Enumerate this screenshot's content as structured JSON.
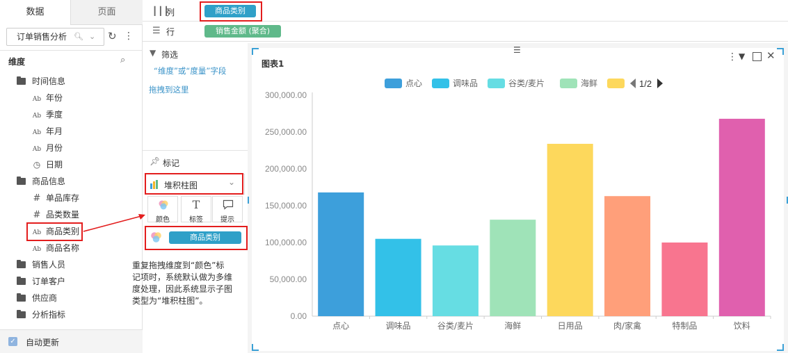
{
  "left_panel": {
    "tabs": [
      "数据",
      "页面"
    ],
    "dataset": "订单销售分析",
    "dimension_title": "维度",
    "tree": [
      {
        "type": "folder",
        "label": "时间信息",
        "children": [
          {
            "type": "text",
            "label": "年份"
          },
          {
            "type": "text",
            "label": "季度"
          },
          {
            "type": "text",
            "label": "年月"
          },
          {
            "type": "text",
            "label": "月份"
          },
          {
            "type": "date",
            "label": "日期"
          }
        ]
      },
      {
        "type": "folder",
        "label": "商品信息",
        "children": [
          {
            "type": "number",
            "label": "单品库存"
          },
          {
            "type": "number",
            "label": "品类数量"
          },
          {
            "type": "text",
            "label": "商品类别"
          },
          {
            "type": "text",
            "label": "商品名称"
          }
        ]
      },
      {
        "type": "folder",
        "label": "销售人员"
      },
      {
        "type": "folder",
        "label": "订单客户"
      },
      {
        "type": "folder",
        "label": "供应商"
      },
      {
        "type": "folder",
        "label": "分析指标"
      }
    ],
    "auto_update": "自动更新"
  },
  "shelf": {
    "column_label": "列",
    "column_pill": "商品类别",
    "row_label": "行",
    "row_pill": "销售金额 (聚合)"
  },
  "filter": {
    "title": "筛选",
    "hint_line1": "“维度”或“度量”字段",
    "hint_line2": "拖拽到这里"
  },
  "marks": {
    "title": "标记",
    "chart_type": "堆积柱图",
    "buttons": [
      "颜色",
      "标签",
      "提示"
    ],
    "color_field": "商品类别"
  },
  "annotation": {
    "lines": [
      "重复拖拽维度到“颜色”标",
      "记项时，系统默认做为多维",
      "度处理，因此系统显示子图",
      "类型为“堆积柱图”。"
    ]
  },
  "chart_data": {
    "type": "bar",
    "title": "图表1",
    "categories": [
      "点心",
      "调味品",
      "谷类/麦片",
      "海鲜",
      "日用品",
      "肉/家禽",
      "特制品",
      "饮料"
    ],
    "values": [
      168000,
      105000,
      96000,
      131000,
      234000,
      163000,
      100000,
      268000
    ],
    "colors": [
      "#3d9fdb",
      "#33c1e8",
      "#66dde3",
      "#9fe3b8",
      "#fdd85c",
      "#ff9f7a",
      "#f8758f",
      "#e060ae"
    ],
    "legend": [
      "点心",
      "调味品",
      "谷类/麦片",
      "海鲜",
      ""
    ],
    "legend_page": "1/2",
    "yticks": [
      "0.00",
      "50,000.00",
      "100,000.00",
      "150,000.00",
      "200,000.00",
      "250,000.00",
      "300,000.00"
    ],
    "ylim": [
      0,
      300000
    ],
    "grid": false,
    "legend_position": "top"
  }
}
